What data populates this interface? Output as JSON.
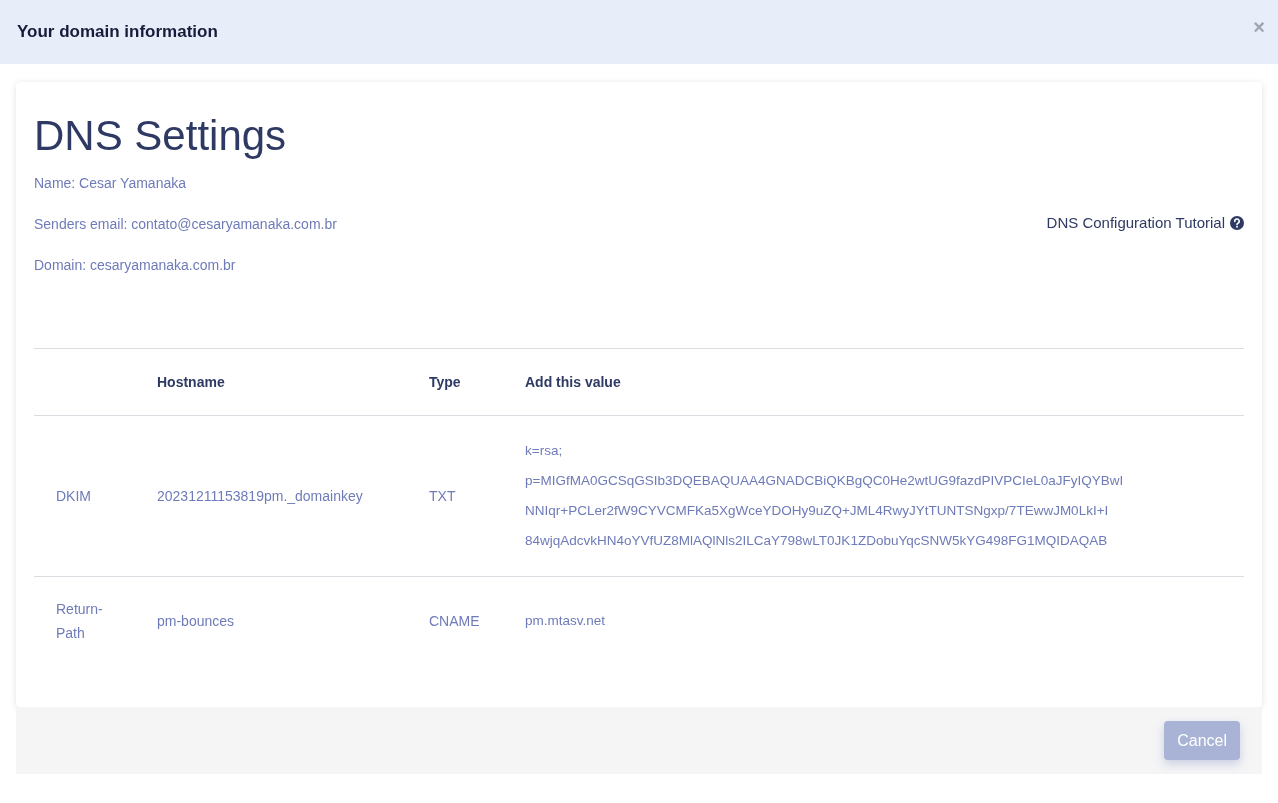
{
  "dialog": {
    "title": "Your domain information",
    "close": "×"
  },
  "heading": "DNS Settings",
  "info": [
    "Name: Cesar Yamanaka",
    "Senders email: contato@cesaryamanaka.com.br",
    "Domain: cesaryamanaka.com.br"
  ],
  "tutorial_link": "DNS Configuration Tutorial",
  "table": {
    "columns": [
      "Hostname",
      "Type",
      "Add this value"
    ],
    "rows": [
      {
        "label": "DKIM",
        "hostname": "20231211153819pm._domainkey",
        "type": "TXT",
        "value": [
          "k=rsa;",
          "p=MIGfMA0GCSqGSIb3DQEBAQUAA4GNADCBiQKBgQC0He2wtUG9fazdPIVPCIeL0aJFyIQYBwI",
          "NNIqr+PCLer2fW9CYVCMFKa5XgWceYDOHy9uZQ+JML4RwyJYtTUNTSNgxp/7TEwwJM0LkI+I",
          "84wjqAdcvkHN4oYVfUZ8MlAQlNls2ILCaY798wLT0JK1ZDobuYqcSNW5kYG498FG1MQIDAQAB"
        ]
      },
      {
        "label": "Return-Path",
        "hostname": "pm-bounces",
        "type": "CNAME",
        "value": [
          "pm.mtasv.net"
        ]
      }
    ]
  },
  "buttons": [
    {
      "label": "Cancel",
      "disabled": true
    }
  ]
}
